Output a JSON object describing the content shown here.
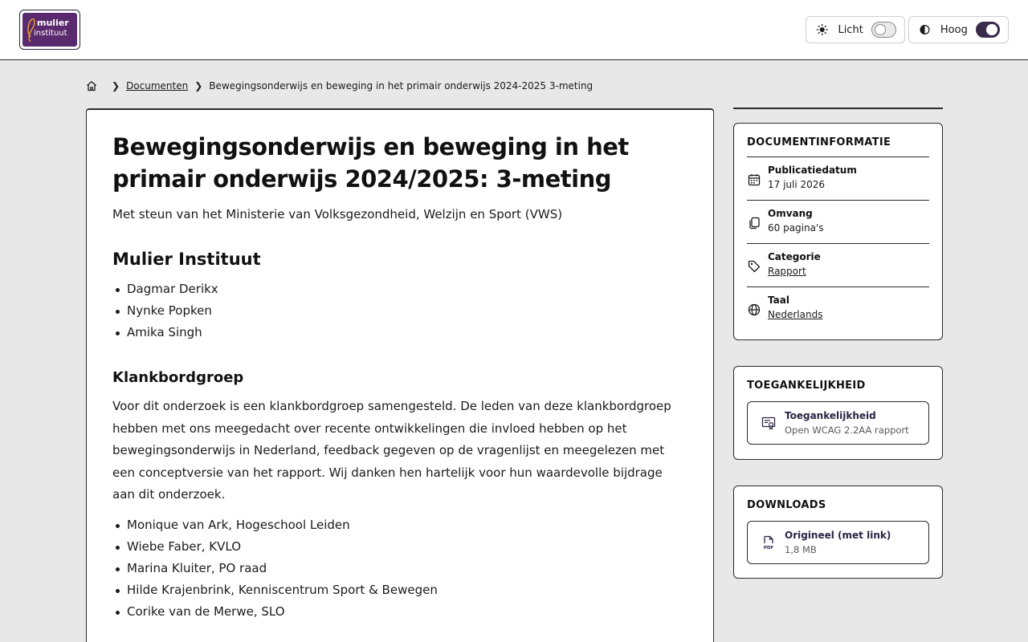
{
  "header": {
    "logo_line1": "mulier",
    "logo_line2": "instituut",
    "theme_toggle": {
      "label": "Licht",
      "state": "off"
    },
    "contrast_toggle": {
      "label": "Hoog",
      "state": "on"
    }
  },
  "breadcrumb": {
    "items": [
      "Documenten"
    ],
    "current": "Bewegingsonderwijs en beweging in het primair onderwijs 2024-2025 3-meting"
  },
  "document": {
    "title": "Bewegingsonderwijs en beweging in het primair onderwijs 2024/2025: 3-meting",
    "subtitle": "Met steun van het Ministerie van Volksgezondheid, Welzijn en Sport (VWS)",
    "section1": {
      "heading": "Mulier Instituut",
      "authors": [
        "Dagmar Derikx",
        "Nynke Popken",
        "Amika Singh"
      ]
    },
    "section2": {
      "heading": "Klankbordgroep",
      "paragraph": "Voor dit onderzoek is een klankbordgroep samengesteld. De leden van deze klankbordgroep hebben met ons meegedacht over recente ontwikkelingen die invloed hebben op het bewegingsonderwijs in Nederland, feedback gegeven op de vragenlijst en meegelezen met een conceptversie van het rapport. Wij danken hen hartelijk voor hun waardevolle bijdrage aan dit onderzoek.",
      "members": [
        "Monique van Ark, Hogeschool Leiden",
        "Wiebe Faber, KVLO",
        "Marina Kluiter, PO raad",
        "Hilde Krajenbrink, Kenniscentrum Sport & Bewegen",
        "Corike van de Merwe, SLO"
      ]
    }
  },
  "sidebar": {
    "info": {
      "heading": "DOCUMENTINFORMATIE",
      "rows": [
        {
          "icon": "calendar-icon",
          "label": "Publicatiedatum",
          "value": "17 juli 2026"
        },
        {
          "icon": "pages-icon",
          "label": "Omvang",
          "value": "60 pagina's"
        },
        {
          "icon": "tag-icon",
          "label": "Categorie",
          "value": "Rapport"
        },
        {
          "icon": "globe-icon",
          "label": "Taal",
          "value": "Nederlands"
        }
      ]
    },
    "accessibility": {
      "heading": "TOEGANKELIJKHEID",
      "link_title": "Toegankelijkheid",
      "link_sub": "Open WCAG 2.2AA rapport"
    },
    "downloads": {
      "heading": "DOWNLOADS",
      "link_title": "Origineel (met link)",
      "link_sub": "1,8 MB"
    }
  },
  "colors": {
    "brand": "#5a2a6e",
    "accent": "#3a2a4e",
    "background": "#e8e8e8"
  }
}
